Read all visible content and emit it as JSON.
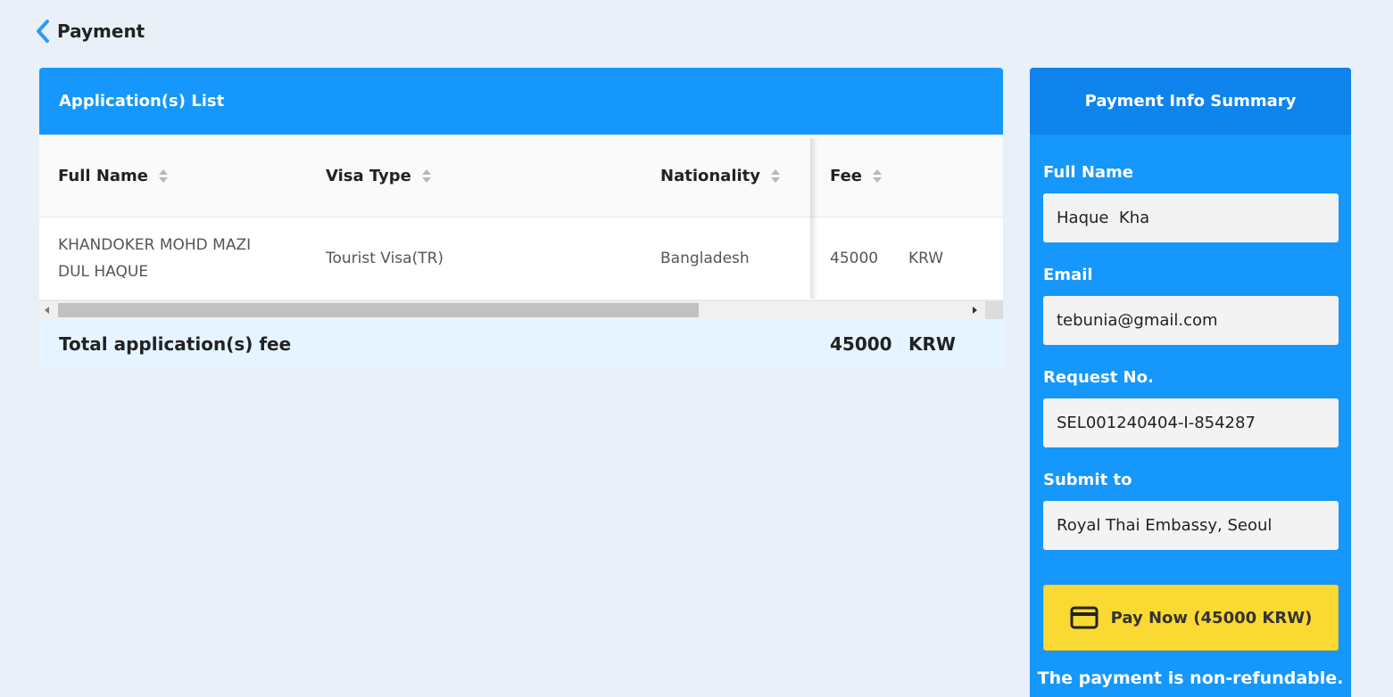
{
  "header": {
    "title": "Payment"
  },
  "applications": {
    "title": "Application(s) List",
    "columns": [
      "Full Name",
      "Visa Type",
      "Nationality",
      "Fee"
    ],
    "rows": [
      {
        "full_name": "KHANDOKER MOHD MAZI DUL HAQUE",
        "visa_type": "Tourist Visa(TR)",
        "nationality": "Bangladesh",
        "fee": "45000",
        "currency": "KRW"
      }
    ],
    "total": {
      "label": "Total application(s) fee",
      "amount": "45000",
      "currency": "KRW"
    }
  },
  "summary": {
    "title": "Payment Info Summary",
    "full_name_label": "Full Name",
    "full_name": "Haque  Kha",
    "email_label": "Email",
    "email": "tebunia@gmail.com",
    "request_no_label": "Request No.",
    "request_no": "SEL001240404-I-854287",
    "submit_to_label": "Submit to",
    "submit_to": "Royal Thai Embassy, Seoul",
    "pay_button": "Pay Now (45000 KRW)",
    "note": "The payment is non-refundable."
  },
  "colors": {
    "primary": "#1597fb",
    "primary_dark": "#0f84ec",
    "pay": "#fbd933",
    "background": "#e9f0f7"
  }
}
